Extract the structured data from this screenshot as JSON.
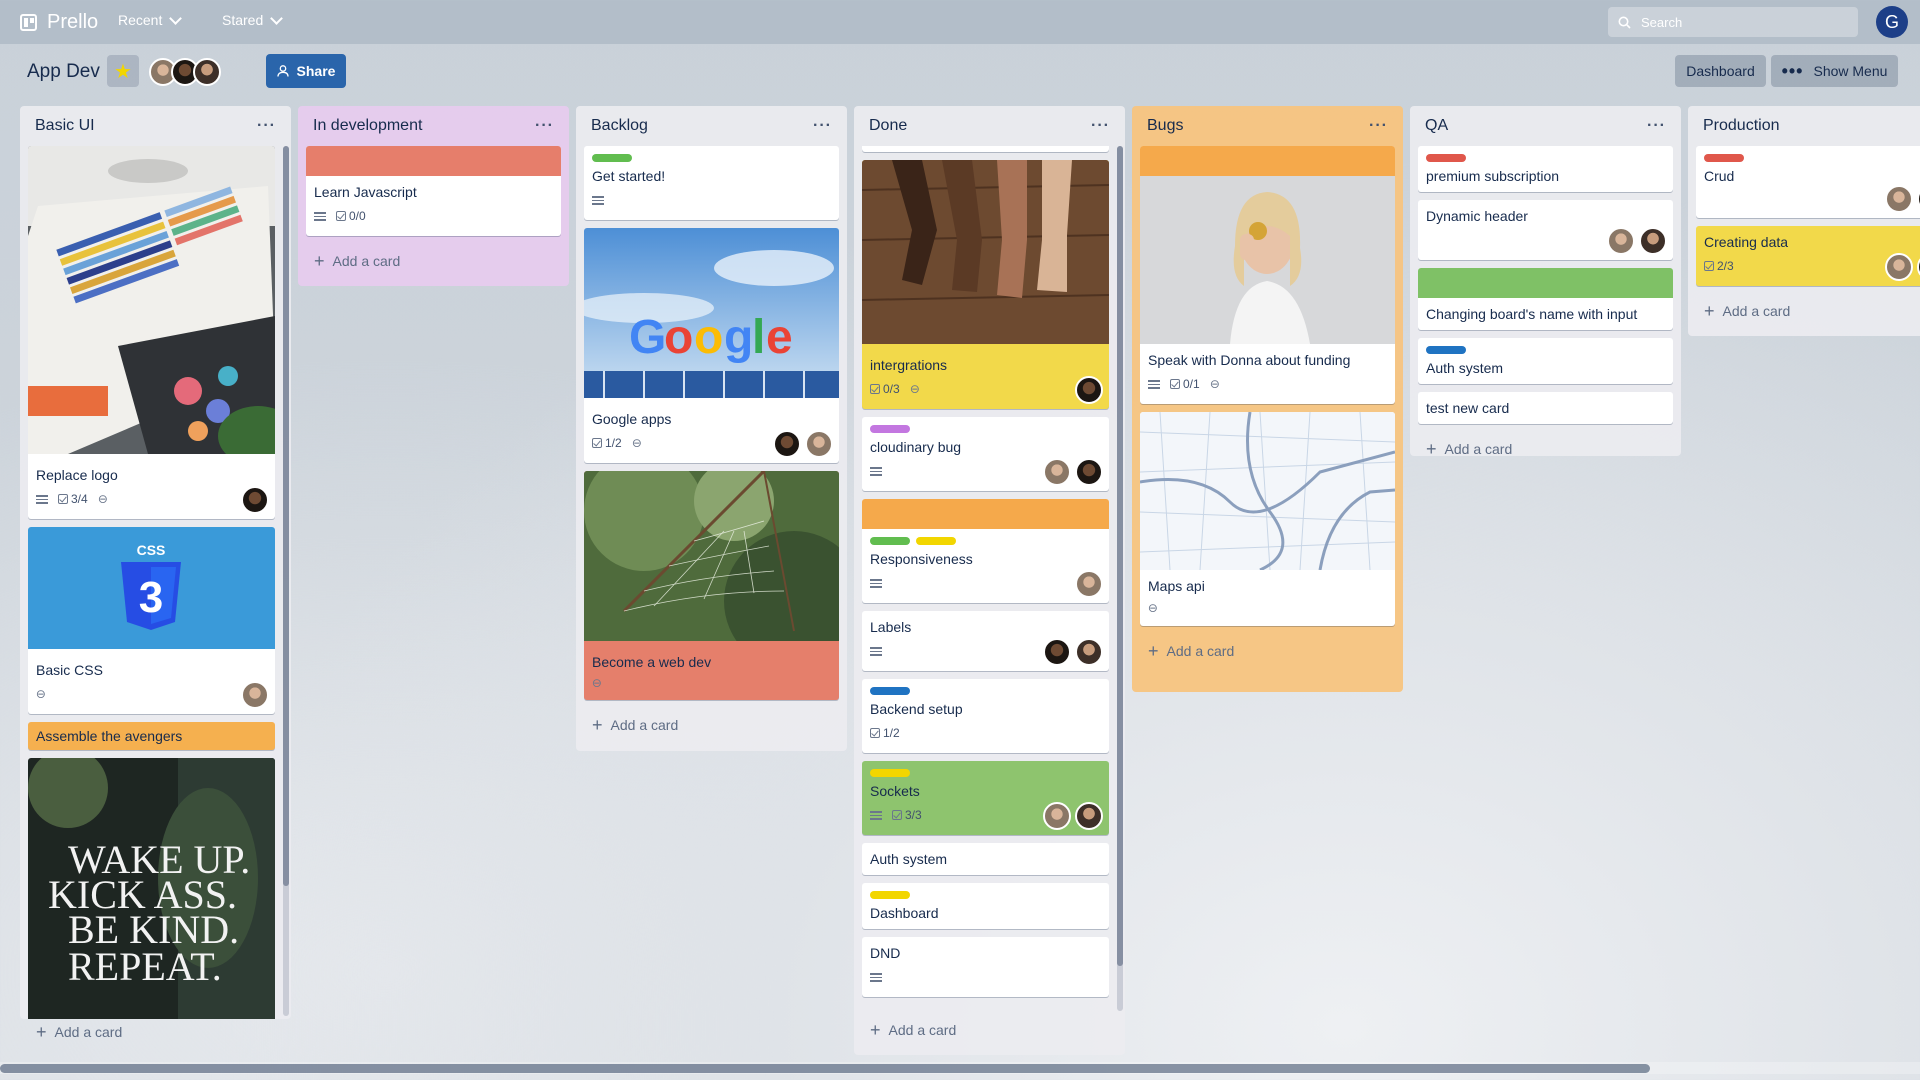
{
  "app": {
    "name": "Prello",
    "recent": "Recent",
    "stared": "Stared",
    "search_placeholder": "Search",
    "user_initial": "G"
  },
  "board": {
    "title": "App Dev",
    "share": "Share",
    "dashboard": "Dashboard",
    "show_menu": "Show Menu"
  },
  "colors": {
    "green": "#61bd4f",
    "yellow": "#f2d600",
    "orange": "#ffab4a",
    "red": "#eb5a46",
    "purple": "#c377e0",
    "blue": "#0079bf"
  },
  "add_card": "Add a card",
  "lists": [
    {
      "title": "Basic UI",
      "cards": [
        {
          "title": "Replace logo",
          "checklist": "3/4"
        },
        {
          "title": "Basic CSS"
        },
        {
          "title": "Assemble the avengers"
        }
      ]
    },
    {
      "title": "In development",
      "cards": [
        {
          "title": "Learn Javascript",
          "checklist": "0/0"
        }
      ]
    },
    {
      "title": "Backlog",
      "cards": [
        {
          "title": "Get started!"
        },
        {
          "title": "Google apps",
          "checklist": "1/2"
        },
        {
          "title": "Become a web dev"
        }
      ]
    },
    {
      "title": "Done",
      "cards": [
        {
          "title": "intergrations",
          "checklist": "0/3"
        },
        {
          "title": "cloudinary bug"
        },
        {
          "title": "Responsiveness"
        },
        {
          "title": "Labels"
        },
        {
          "title": "Backend setup",
          "checklist": "1/2"
        },
        {
          "title": "Sockets",
          "checklist": "3/3"
        },
        {
          "title": "Auth system"
        },
        {
          "title": "Dashboard"
        },
        {
          "title": "DND"
        }
      ]
    },
    {
      "title": "Bugs",
      "cards": [
        {
          "title": "Speak with Donna about funding",
          "checklist": "0/1"
        },
        {
          "title": "Maps api"
        }
      ]
    },
    {
      "title": "QA",
      "cards": [
        {
          "title": "premium subscription"
        },
        {
          "title": "Dynamic header"
        },
        {
          "title": "Changing board's name with input"
        },
        {
          "title": "Auth system"
        },
        {
          "title": "test new card"
        }
      ]
    },
    {
      "title": "Production",
      "cards": [
        {
          "title": "Crud"
        },
        {
          "title": "Creating data",
          "checklist": "2/3"
        }
      ]
    }
  ]
}
